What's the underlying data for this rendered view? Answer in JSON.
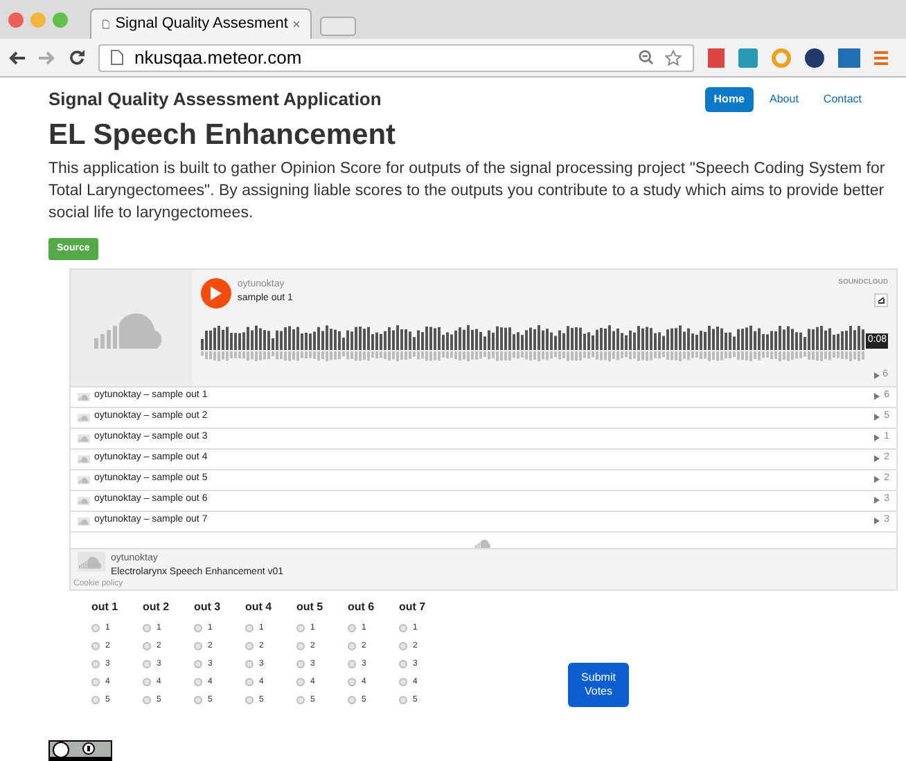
{
  "browser": {
    "tab_title": "Signal Quality Assesment",
    "url": "nkusqaa.meteor.com"
  },
  "nav": {
    "brand": "Signal Quality Assessment Application",
    "links": [
      {
        "label": "Home",
        "selected": true
      },
      {
        "label": "About",
        "selected": false
      },
      {
        "label": "Contact",
        "selected": false
      }
    ]
  },
  "heading": "EL Speech Enhancement",
  "intro": "This application is built to gather Opinion Score for outputs of the signal processing project \"Speech Coding System for Total Laryngectomees\". By assigning liable scores to the outputs you contribute to a study which aims to provide better social life to laryngectomees.",
  "source_button": "Source",
  "player": {
    "user": "oytunoktay",
    "track": "sample out 1",
    "brand": "SOUNDCLOUD",
    "duration": "0:08",
    "play_count": "6",
    "tracks": [
      {
        "title": "oytunoktay – sample out 1",
        "plays": "6"
      },
      {
        "title": "oytunoktay – sample out 2",
        "plays": "5"
      },
      {
        "title": "oytunoktay – sample out 3",
        "plays": "1"
      },
      {
        "title": "oytunoktay – sample out 4",
        "plays": "2"
      },
      {
        "title": "oytunoktay – sample out 5",
        "plays": "2"
      },
      {
        "title": "oytunoktay – sample out 6",
        "plays": "3"
      },
      {
        "title": "oytunoktay – sample out 7",
        "plays": "3"
      }
    ],
    "footer_user": "oytunoktay",
    "playlist": "Electrolarynx Speech Enhancement v01",
    "cookie": "Cookie policy"
  },
  "votes": [
    {
      "label": "out 1",
      "options": [
        {
          "label": "1",
          "selected": false
        },
        {
          "label": "2",
          "selected": false
        },
        {
          "label": "3",
          "selected": false
        },
        {
          "label": "4",
          "selected": false
        },
        {
          "label": "5",
          "selected": false
        }
      ]
    },
    {
      "label": "out 2",
      "options": [
        {
          "label": "1",
          "selected": false
        },
        {
          "label": "2",
          "selected": false
        },
        {
          "label": "3",
          "selected": false
        },
        {
          "label": "4",
          "selected": false
        },
        {
          "label": "5",
          "selected": false
        }
      ]
    },
    {
      "label": "out 3",
      "options": [
        {
          "label": "1",
          "selected": false
        },
        {
          "label": "2",
          "selected": false
        },
        {
          "label": "3",
          "selected": false
        },
        {
          "label": "4",
          "selected": false
        },
        {
          "label": "5",
          "selected": false
        }
      ]
    },
    {
      "label": "out 4",
      "options": [
        {
          "label": "1",
          "selected": false
        },
        {
          "label": "2",
          "selected": false
        },
        {
          "label": "3",
          "selected": false
        },
        {
          "label": "4",
          "selected": false
        },
        {
          "label": "5",
          "selected": false
        }
      ]
    },
    {
      "label": "out 5",
      "options": [
        {
          "label": "1",
          "selected": false
        },
        {
          "label": "2",
          "selected": false
        },
        {
          "label": "3",
          "selected": false
        },
        {
          "label": "4",
          "selected": false
        },
        {
          "label": "5",
          "selected": false
        }
      ]
    },
    {
      "label": "out 6",
      "options": [
        {
          "label": "1",
          "selected": false
        },
        {
          "label": "2",
          "selected": false
        },
        {
          "label": "3",
          "selected": false
        },
        {
          "label": "4",
          "selected": false
        },
        {
          "label": "5",
          "selected": false
        }
      ]
    },
    {
      "label": "out 7",
      "options": [
        {
          "label": "1",
          "selected": false
        },
        {
          "label": "2",
          "selected": false
        },
        {
          "label": "3",
          "selected": false
        },
        {
          "label": "4",
          "selected": false
        },
        {
          "label": "5",
          "selected": false
        }
      ]
    }
  ],
  "submit": "Submit Votes"
}
